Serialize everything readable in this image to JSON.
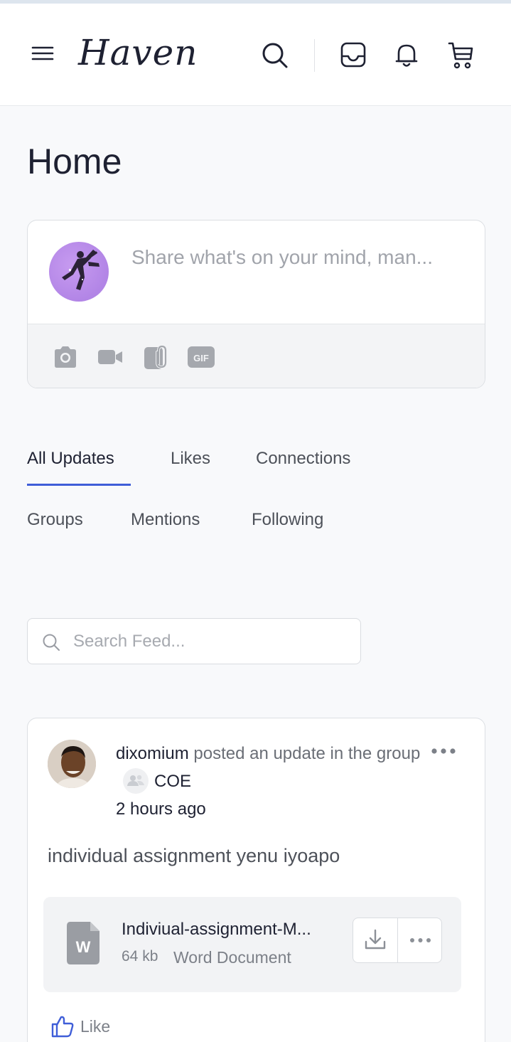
{
  "header": {
    "logo": "Haven",
    "icons": [
      "menu-icon",
      "search-icon",
      "inbox-icon",
      "bell-icon",
      "cart-icon"
    ]
  },
  "page": {
    "title": "Home"
  },
  "composer": {
    "placeholder": "Share what's on your mind, man...",
    "tools": [
      "camera-icon",
      "video-icon",
      "attachment-icon",
      "gif-icon"
    ],
    "gif_label": "GIF"
  },
  "tabs": {
    "items": [
      {
        "label": "All Updates",
        "active": true
      },
      {
        "label": "Likes"
      },
      {
        "label": "Connections"
      },
      {
        "label": "Groups"
      },
      {
        "label": "Mentions"
      },
      {
        "label": "Following"
      }
    ]
  },
  "search": {
    "placeholder": "Search Feed..."
  },
  "post": {
    "author": "dixomium",
    "action_text": " posted an update in the group",
    "group": "COE",
    "time": "2 hours ago",
    "body": "individual assignment yenu iyoapo",
    "attachment": {
      "file_name": "Indiviual-assignment-M...",
      "size": "64 kb",
      "type": "Word Document",
      "icon_letter": "W"
    },
    "like_label": "Like"
  },
  "colors": {
    "accent": "#3f5ed8",
    "text_primary": "#1e2132",
    "text_muted": "#7c8088",
    "background": "#f8f9fb"
  }
}
